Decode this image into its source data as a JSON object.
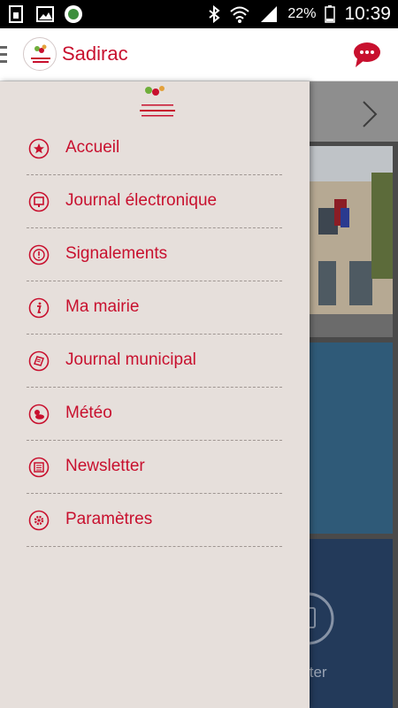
{
  "status_bar": {
    "battery_percent": "22%",
    "time": "10:39"
  },
  "app_bar": {
    "title": "Sadirac"
  },
  "drawer": {
    "menu": [
      {
        "label": "Accueil",
        "icon": "star-icon"
      },
      {
        "label": "Journal électronique",
        "icon": "screen-icon"
      },
      {
        "label": "Signalements",
        "icon": "alert-icon"
      },
      {
        "label": "Ma mairie",
        "icon": "info-icon"
      },
      {
        "label": "Journal municipal",
        "icon": "newspaper-icon"
      },
      {
        "label": "Météo",
        "icon": "weather-icon"
      },
      {
        "label": "Newsletter",
        "icon": "newsletter-icon"
      },
      {
        "label": "Paramètres",
        "icon": "gear-icon"
      }
    ]
  },
  "background": {
    "tile_label_partial": "tter"
  },
  "colors": {
    "accent": "#c8102e",
    "drawer_bg": "#e6dfdb"
  }
}
